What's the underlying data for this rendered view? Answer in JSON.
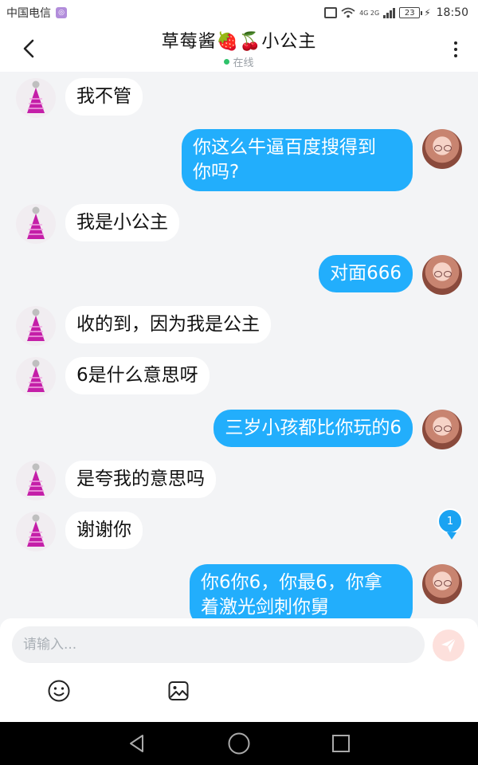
{
  "status_bar": {
    "carrier": "中国电信",
    "network_type": "4G 2G",
    "battery_level": "23",
    "time": "18:50"
  },
  "header": {
    "title": "草莓酱🍓🍒小公主",
    "status": "在线"
  },
  "messages": [
    {
      "side": "left",
      "text": "我不管"
    },
    {
      "side": "right",
      "text": "你这么牛逼百度搜得到\n你吗?"
    },
    {
      "side": "left",
      "text": "我是小公主"
    },
    {
      "side": "right",
      "text": "对面666"
    },
    {
      "side": "left",
      "text": "收的到，因为我是公主"
    },
    {
      "side": "left",
      "text": "6是什么意思呀"
    },
    {
      "side": "right",
      "text": "三岁小孩都比你玩的6"
    },
    {
      "side": "left",
      "text": "是夸我的意思吗"
    },
    {
      "side": "left",
      "text": "谢谢你"
    },
    {
      "side": "right",
      "text": "你6你6，你最6，你拿\n着激光剑刺你舅"
    }
  ],
  "unread_badge": "1",
  "input": {
    "placeholder": "请输入..."
  },
  "icons": {
    "back": "chevron-left-icon",
    "more": "more-vertical-icon",
    "send": "send-icon",
    "emoji": "emoji-icon",
    "image": "image-icon"
  },
  "colors": {
    "accent": "#22aefc",
    "background": "#f3f4f6",
    "online": "#2ec26a",
    "send_button": "#fde0dc"
  }
}
